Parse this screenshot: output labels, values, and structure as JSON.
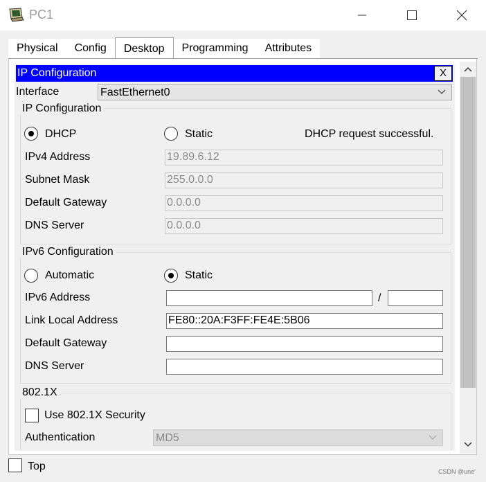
{
  "window": {
    "title": "PC1"
  },
  "tabs": [
    "Physical",
    "Config",
    "Desktop",
    "Programming",
    "Attributes"
  ],
  "active_tab": "Desktop",
  "ip_config": {
    "header": "IP Configuration",
    "close_label": "X",
    "interface_label": "Interface",
    "interface_value": "FastEthernet0"
  },
  "ipv4": {
    "group_title": "IP Configuration",
    "dhcp_label": "DHCP",
    "static_label": "Static",
    "mode": "DHCP",
    "status": "DHCP request successful.",
    "address_label": "IPv4 Address",
    "address_value": "19.89.6.12",
    "mask_label": "Subnet Mask",
    "mask_value": "255.0.0.0",
    "gateway_label": "Default Gateway",
    "gateway_value": "0.0.0.0",
    "dns_label": "DNS Server",
    "dns_value": "0.0.0.0"
  },
  "ipv6": {
    "group_title": "IPv6 Configuration",
    "automatic_label": "Automatic",
    "static_label": "Static",
    "mode": "Static",
    "address_label": "IPv6 Address",
    "address_value": "",
    "prefix_separator": "/",
    "prefix_value": "",
    "link_local_label": "Link Local Address",
    "link_local_value": "FE80::20A:F3FF:FE4E:5B06",
    "gateway_label": "Default Gateway",
    "gateway_value": "",
    "dns_label": "DNS Server",
    "dns_value": ""
  },
  "dot1x": {
    "group_title": "802.1X",
    "security_label": "Use 802.1X Security",
    "security_checked": false,
    "auth_label": "Authentication",
    "auth_value": "MD5"
  },
  "footer": {
    "top_label": "Top",
    "top_checked": false
  },
  "watermark": "CSDN @une'",
  "colors": {
    "header_bg": "#0000ff",
    "header_fg": "#ffffff",
    "chrome_bg": "#f0f0f0"
  }
}
